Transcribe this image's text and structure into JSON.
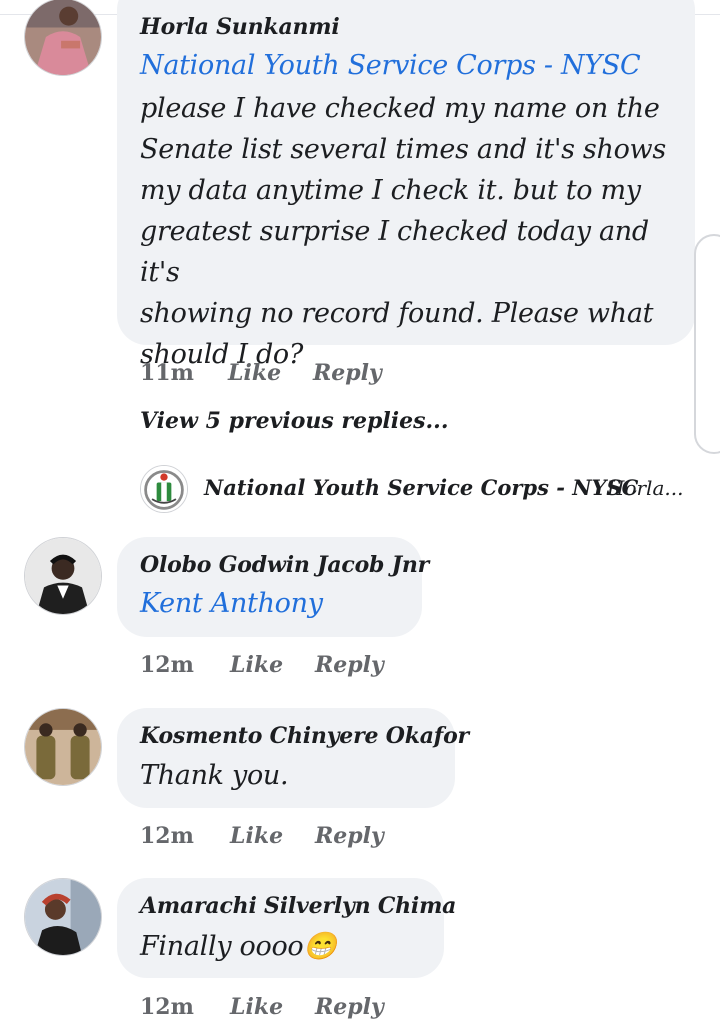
{
  "comments": [
    {
      "author": "Horla Sunkanmi",
      "tag": "National Youth Service Corps - NYSC",
      "lines": [
        "please I have checked my name on the",
        "Senate list several  times and it's shows",
        "my data anytime I check it. but to my",
        "greatest surprise I checked today and it's",
        "showing no record found. Please what",
        "should I do?"
      ],
      "time": "11m",
      "like_label": "Like",
      "reply_label": "Reply",
      "view_previous": "View 5 previous replies...",
      "latest_reply": {
        "author": "National Youth Service Corps - NYSC",
        "snippet": "Horla..."
      }
    },
    {
      "author": "Olobo Godwin Jacob Jnr",
      "tag": "Kent Anthony",
      "time": "12m",
      "like_label": "Like",
      "reply_label": "Reply"
    },
    {
      "author": "Kosmento Chinyere Okafor",
      "text": "Thank you.",
      "time": "12m",
      "like_label": "Like",
      "reply_label": "Reply"
    },
    {
      "author": "Amarachi Silverlyn Chima",
      "text": "Finally oooo",
      "emoji": "😁",
      "time": "12m",
      "like_label": "Like",
      "reply_label": "Reply"
    }
  ],
  "colors": {
    "bubble": "#f0f2f5",
    "tag_link": "#216fdb",
    "meta": "#65676b",
    "text": "#1c1e21"
  }
}
